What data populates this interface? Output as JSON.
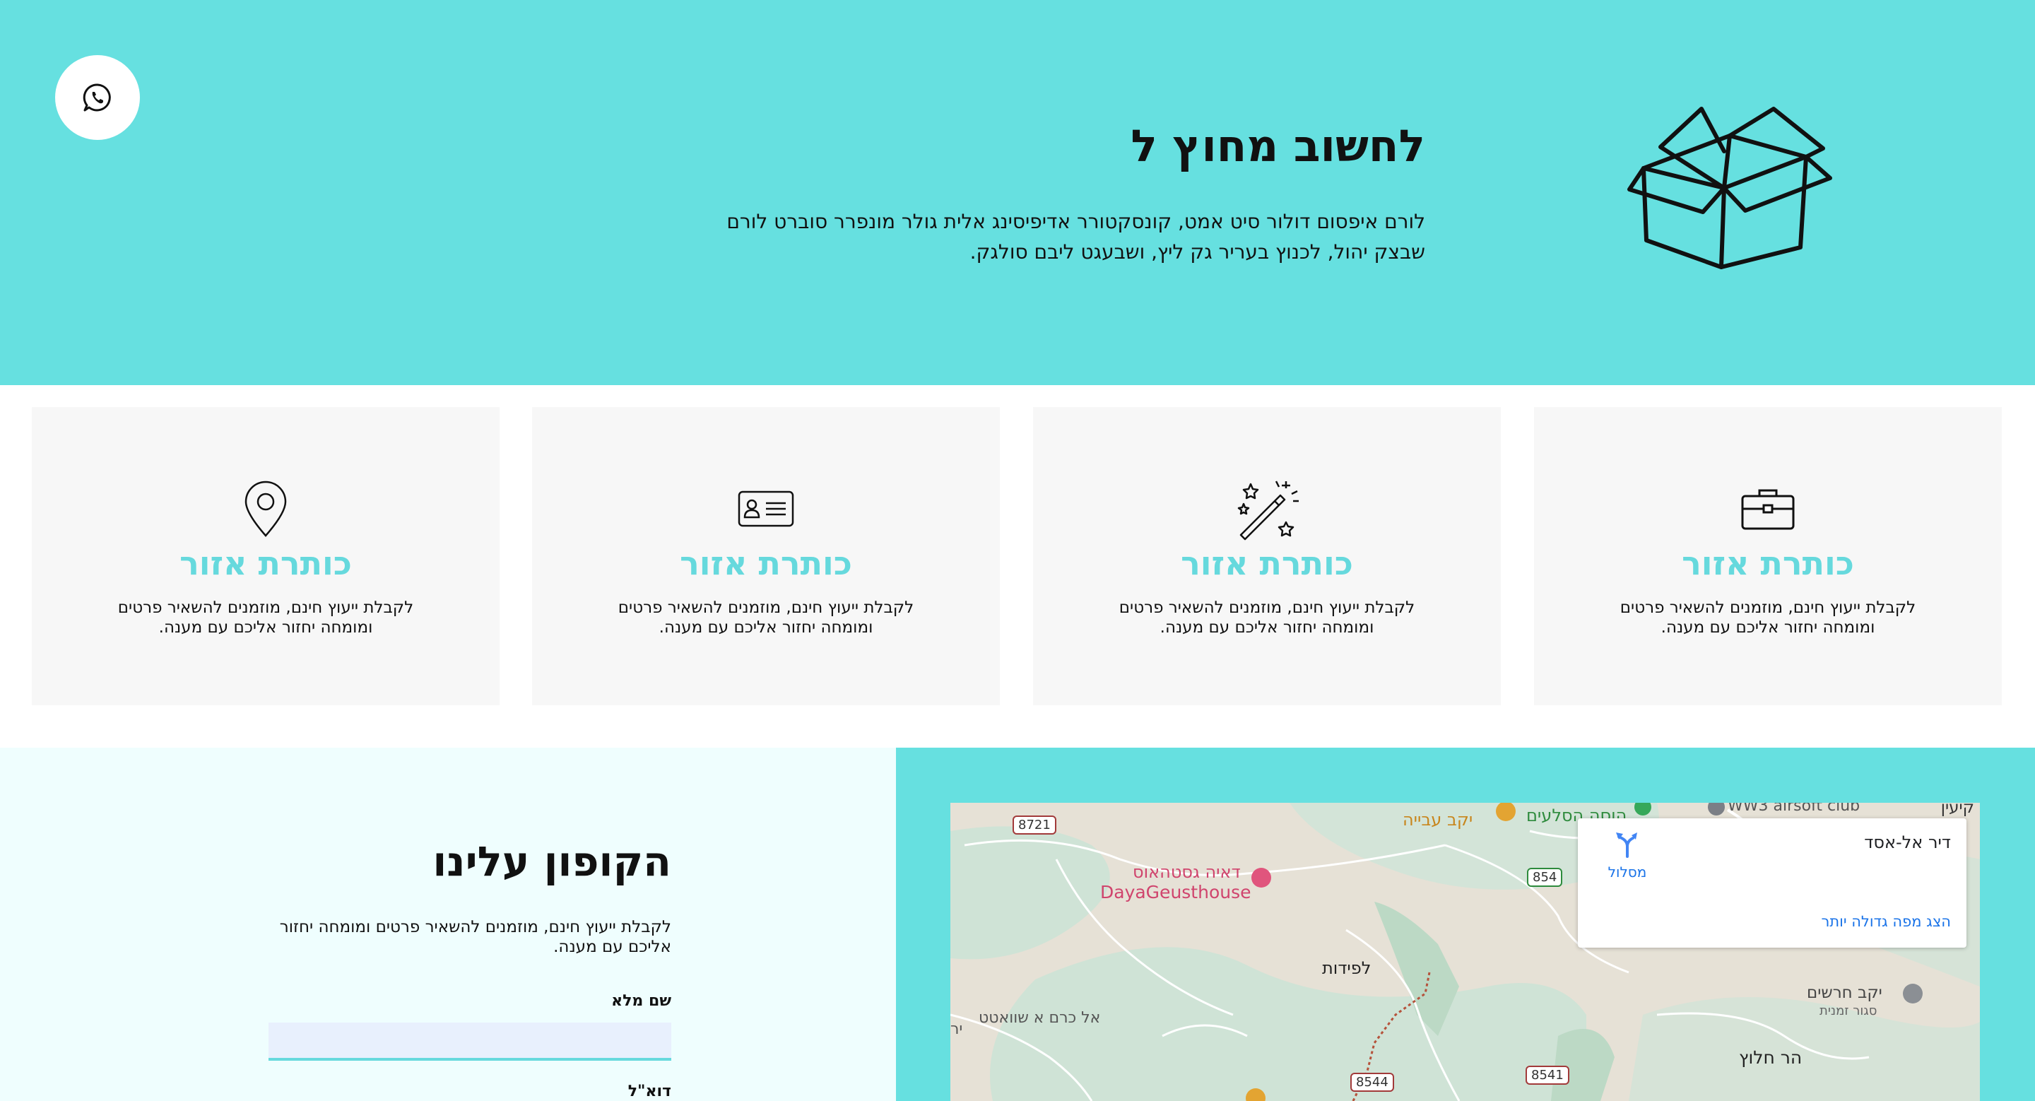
{
  "hero": {
    "title": "לחשוב מחוץ ל",
    "text": "לורם איפסום דולור סיט אמט, קונסקטורר אדיפיסינג אלית גולר מונפרר סוברט לורם שבצק יהול, לכנוץ בעריר גק ליץ, ושבעגט ליבם סולגק.",
    "whatsapp_icon": "whatsapp-icon",
    "box_icon": "open-box-icon",
    "bg_color": "#66e0e0"
  },
  "features": [
    {
      "icon": "briefcase-icon",
      "title": "כותרת אזור",
      "text": "לקבלת ייעוץ חינם, מוזמנים להשאיר פרטים ומומחה יחזור אליכם עם מענה."
    },
    {
      "icon": "magic-wand-icon",
      "title": "כותרת אזור",
      "text": "לקבלת ייעוץ חינם, מוזמנים להשאיר פרטים ומומחה יחזור אליכם עם מענה."
    },
    {
      "icon": "id-card-icon",
      "title": "כותרת אזור",
      "text": "לקבלת ייעוץ חינם, מוזמנים להשאיר פרטים ומומחה יחזור אליכם עם מענה."
    },
    {
      "icon": "location-pin-icon",
      "title": "כותרת אזור",
      "text": "לקבלת ייעוץ חינם, מוזמנים להשאיר פרטים ומומחה יחזור אליכם עם מענה."
    }
  ],
  "coupon": {
    "title": "הקופון עלינו",
    "text": "לקבלת ייעוץ חינם, מוזמנים להשאיר פרטים ומומחה יחזור אליכם עם מענה.",
    "name_label": "שם מלא",
    "name_value": "",
    "email_label": "דוא\"ל"
  },
  "map": {
    "card": {
      "place_name": "דיר אל-אסד",
      "directions_label": "מסלול",
      "bigger_map_label": "הצג מפה גדולה יותר"
    },
    "labels": {
      "top_right": "קיעין",
      "airsoft": "WW3 airsoft club",
      "rocks": "הוסה הסלעים",
      "winery": "יקב עבייה",
      "guesthouse_he": "דאיה גסטהאוס",
      "guesthouse_en": "DayaGeusthouse",
      "lapidot": "לפידות",
      "kerem": "אל כרם א שוואטט",
      "kerem_cut": "יר",
      "kharashim_winery": "יקב חרשים",
      "kharashim_sub": "סגור זמנית",
      "halutz": "הר חלוץ"
    },
    "route_numbers": {
      "r8721": "8721",
      "r854": "854",
      "r8544": "8544",
      "r8541": "8541"
    }
  },
  "colors": {
    "accent": "#66e0e0",
    "card_title": "#66d9dd",
    "card_bg": "#f7f7f7",
    "coupon_bg": "#effefe",
    "link": "#1a73e8"
  }
}
